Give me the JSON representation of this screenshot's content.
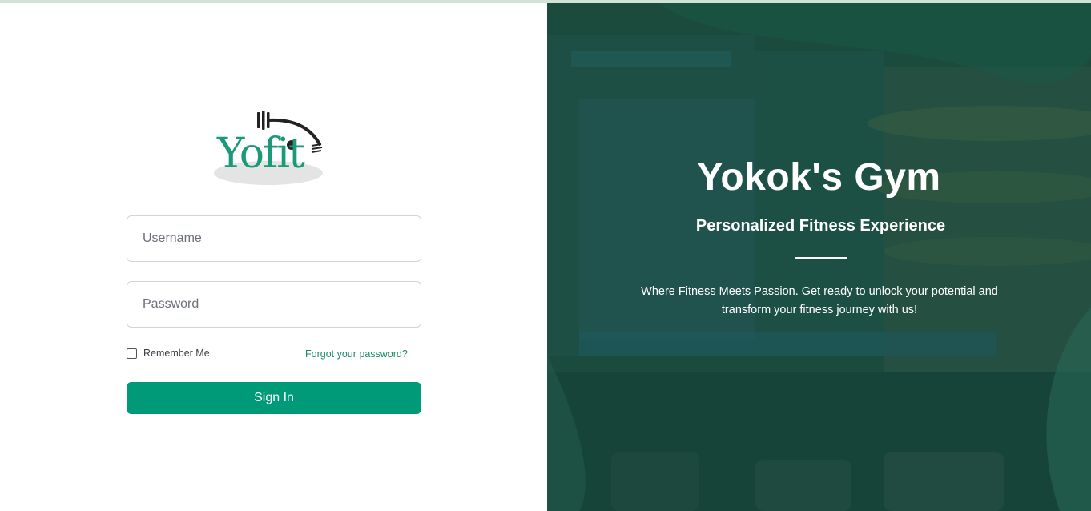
{
  "brand": {
    "logo_text": "Yofit"
  },
  "login": {
    "username_placeholder": "Username",
    "password_placeholder": "Password",
    "remember_label": "Remember Me",
    "forgot_label": "Forgot your password?",
    "signin_label": "Sign In"
  },
  "hero": {
    "title": "Yokok's Gym",
    "subtitle": "Personalized Fitness Experience",
    "description": "Where Fitness Meets Passion. Get ready to unlock your potential and transform your fitness journey with us!"
  },
  "colors": {
    "accent": "#009a78",
    "link": "#1a8a6a",
    "hero_overlay": "#1f4c3f"
  }
}
